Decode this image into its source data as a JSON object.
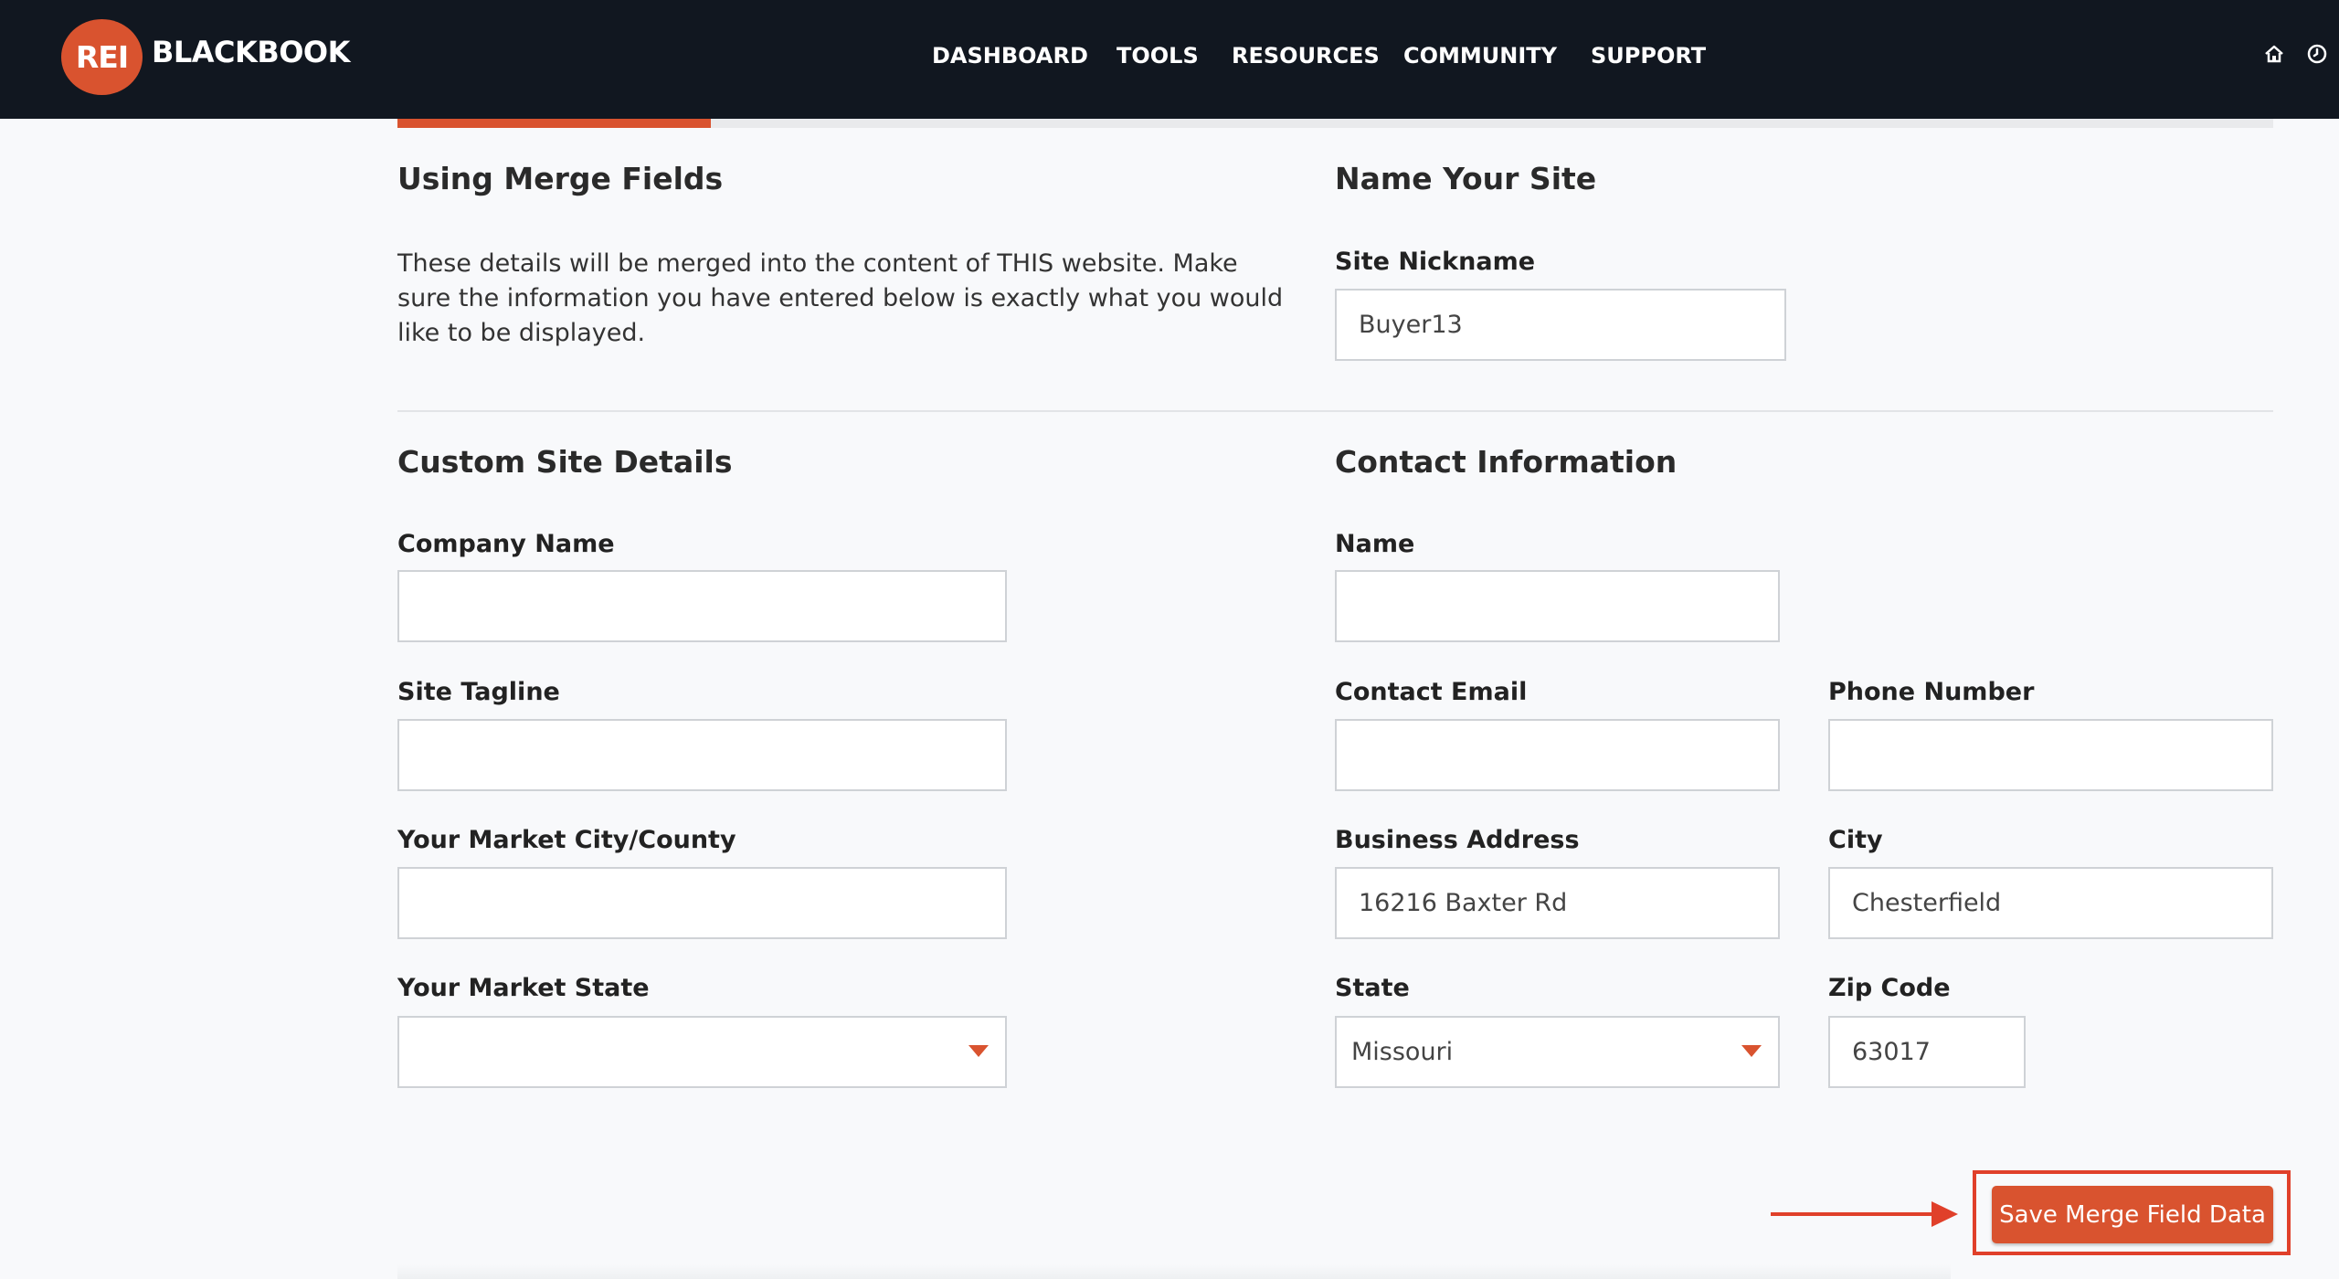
{
  "header": {
    "logo_badge": "REI",
    "logo_text": "BLACKBOOK",
    "nav": [
      "DASHBOARD",
      "TOOLS",
      "RESOURCES",
      "COMMUNITY",
      "SUPPORT"
    ],
    "icons": [
      "home-icon",
      "clock-icon"
    ]
  },
  "merge": {
    "title": "Using Merge Fields",
    "description": "These details will be merged into the content of THIS website. Make sure the information you have entered below is exactly what you would like to be displayed."
  },
  "site": {
    "title": "Name Your Site",
    "nickname_label": "Site Nickname",
    "nickname_value": "Buyer13"
  },
  "custom": {
    "title": "Custom Site Details",
    "company_label": "Company Name",
    "company_value": "",
    "tagline_label": "Site Tagline",
    "tagline_value": "",
    "city_county_label": "Your Market City/County",
    "city_county_value": "",
    "state_label": "Your Market State",
    "state_value": ""
  },
  "contact": {
    "title": "Contact Information",
    "name_label": "Name",
    "name_value": "",
    "email_label": "Contact Email",
    "email_value": "",
    "phone_label": "Phone Number",
    "phone_value": "",
    "address_label": "Business Address",
    "address_value": "16216 Baxter Rd",
    "city_label": "City",
    "city_value": "Chesterfield",
    "state_label": "State",
    "state_value": "Missouri",
    "zip_label": "Zip Code",
    "zip_value": "63017"
  },
  "actions": {
    "save_label": "Save Merge Field Data"
  },
  "colors": {
    "brand": "#d9532f",
    "header_bg": "#111720",
    "highlight": "#e0402a"
  }
}
